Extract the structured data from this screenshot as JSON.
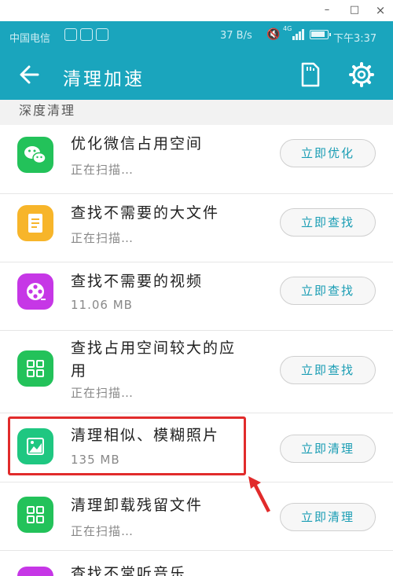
{
  "window": {
    "min": "–",
    "max": "□",
    "close": "×"
  },
  "status_bar": {
    "carrier": "中国电信",
    "speed": "37 B/s",
    "net_label": "4G",
    "time": "下午3:37"
  },
  "header": {
    "title": "清理加速",
    "back_icon": "back-arrow-icon",
    "sd_icon": "sd-card-icon",
    "settings_icon": "gear-icon"
  },
  "section": {
    "title": "深度清理"
  },
  "items": [
    {
      "title": "优化微信占用空间",
      "subtitle": "正在扫描…",
      "action": "立即优化",
      "icon": "wechat-icon",
      "color": "#23c25a"
    },
    {
      "title": "查找不需要的大文件",
      "subtitle": "正在扫描…",
      "action": "立即查找",
      "icon": "document-icon",
      "color": "#f7b52a"
    },
    {
      "title": "查找不需要的视频",
      "subtitle": "11.06 MB",
      "action": "立即查找",
      "icon": "video-reel-icon",
      "color": "#c637e6"
    },
    {
      "title": "查找占用空间较大的应用",
      "subtitle": "正在扫描…",
      "action": "立即查找",
      "icon": "apps-grid-icon",
      "color": "#23c25a"
    },
    {
      "title": "清理相似、模糊照片",
      "subtitle": "135 MB",
      "action": "立即清理",
      "icon": "photo-icon",
      "color": "#1fc781"
    },
    {
      "title": "清理卸载残留文件",
      "subtitle": "正在扫描…",
      "action": "立即清理",
      "icon": "apps-grid-icon",
      "color": "#23c25a"
    },
    {
      "title": "查找不常听音乐",
      "subtitle": "",
      "action": "",
      "icon": "music-icon",
      "color": "#c637e6"
    }
  ]
}
